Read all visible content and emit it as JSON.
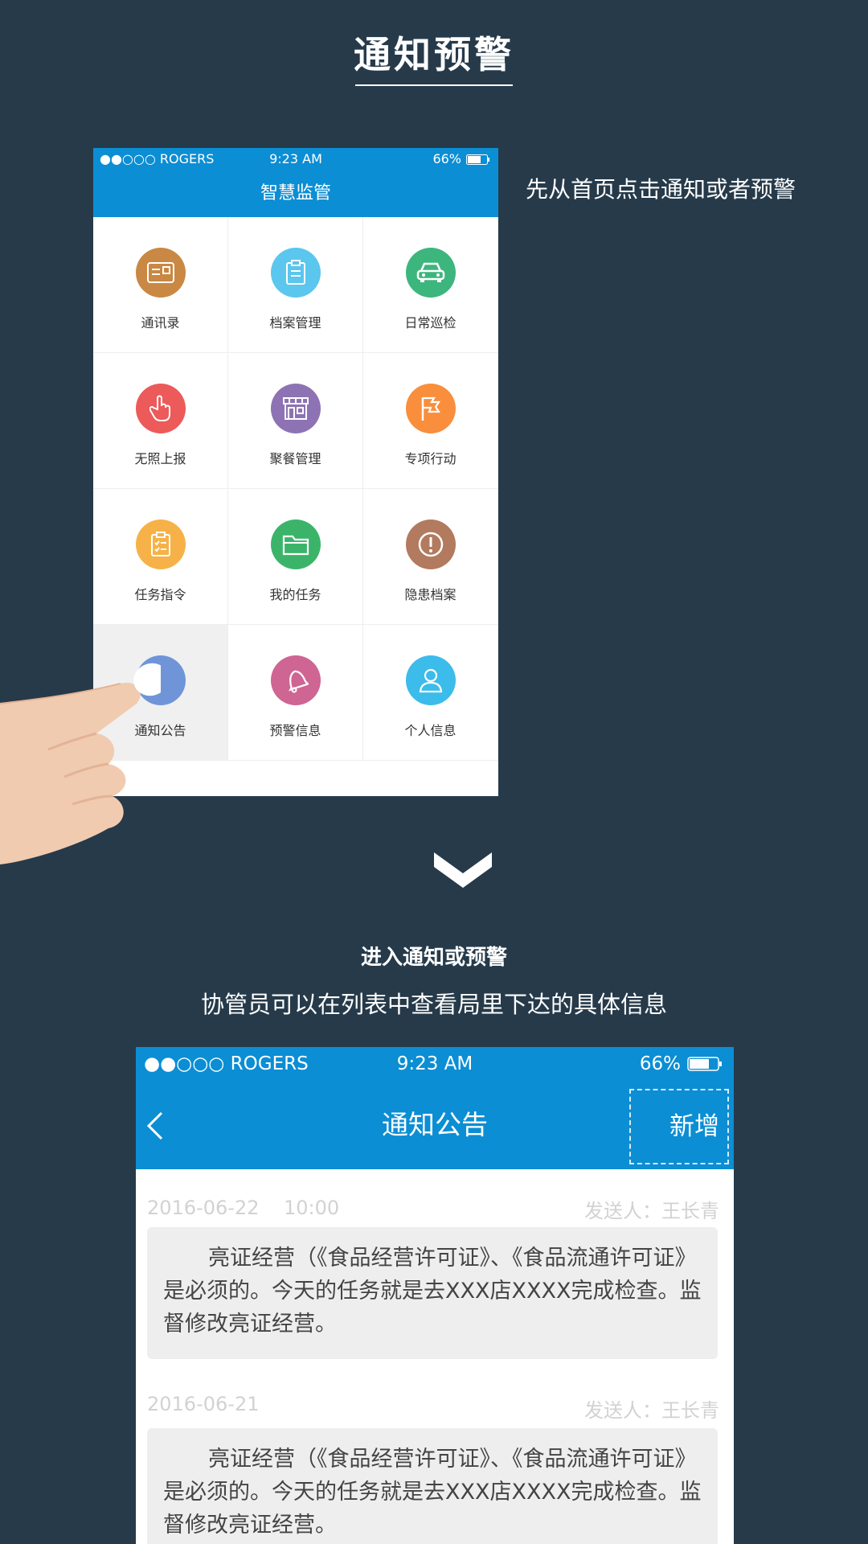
{
  "page": {
    "title": "通知预警",
    "step1_text": "先从首页点击通知或者预警",
    "step2_title": "进入通知或预警",
    "step2_subtitle": "协管员可以在列表中查看局里下达的具体信息"
  },
  "phone1": {
    "status": {
      "carrier": "●●○○○ ROGERS",
      "time": "9:23 AM",
      "battery": "66%"
    },
    "nav_title": "智慧监管",
    "tiles": [
      {
        "label": "通讯录",
        "icon": "contact-card-icon",
        "color": "#c98843"
      },
      {
        "label": "档案管理",
        "icon": "clipboard-icon",
        "color": "#5bc6ee"
      },
      {
        "label": "日常巡检",
        "icon": "car-icon",
        "color": "#3db67e"
      },
      {
        "label": "无照上报",
        "icon": "hand-pointer-icon",
        "color": "#ec5a5a"
      },
      {
        "label": "聚餐管理",
        "icon": "storefront-icon",
        "color": "#8d73b3"
      },
      {
        "label": "专项行动",
        "icon": "flag-icon",
        "color": "#f98e3c"
      },
      {
        "label": "任务指令",
        "icon": "checklist-icon",
        "color": "#f6b248"
      },
      {
        "label": "我的任务",
        "icon": "folder-icon",
        "color": "#3bb46a"
      },
      {
        "label": "隐患档案",
        "icon": "warning-icon",
        "color": "#b27a5f"
      },
      {
        "label": "通知公告",
        "icon": "notice-icon",
        "color": "#6f95d8"
      },
      {
        "label": "预警信息",
        "icon": "bell-icon",
        "color": "#cf6593"
      },
      {
        "label": "个人信息",
        "icon": "person-icon",
        "color": "#3cbcea"
      }
    ]
  },
  "phone2": {
    "status": {
      "carrier": "●●○○○ ROGERS",
      "time": "9:23 AM",
      "battery": "66%"
    },
    "nav_title": "通知公告",
    "add_label": "新增",
    "messages": [
      {
        "date": "2016-06-22",
        "time": "10:00",
        "sender": "发送人：王长青",
        "body": "亮证经营（《食品经营许可证》、《食品流通许可证》是必须的。今天的任务就是去XXX店XXXX完成检查。监督修改亮证经营。"
      },
      {
        "date": "2016-06-21",
        "time": "",
        "sender": "发送人：王长青",
        "body": "亮证经营（《食品经营许可证》、《食品流通许可证》是必须的。今天的任务就是去XXX店XXXX完成检查。监督修改亮证经营。"
      }
    ]
  },
  "colors": {
    "background": "#263a4a",
    "accent": "#0b8ed4"
  }
}
